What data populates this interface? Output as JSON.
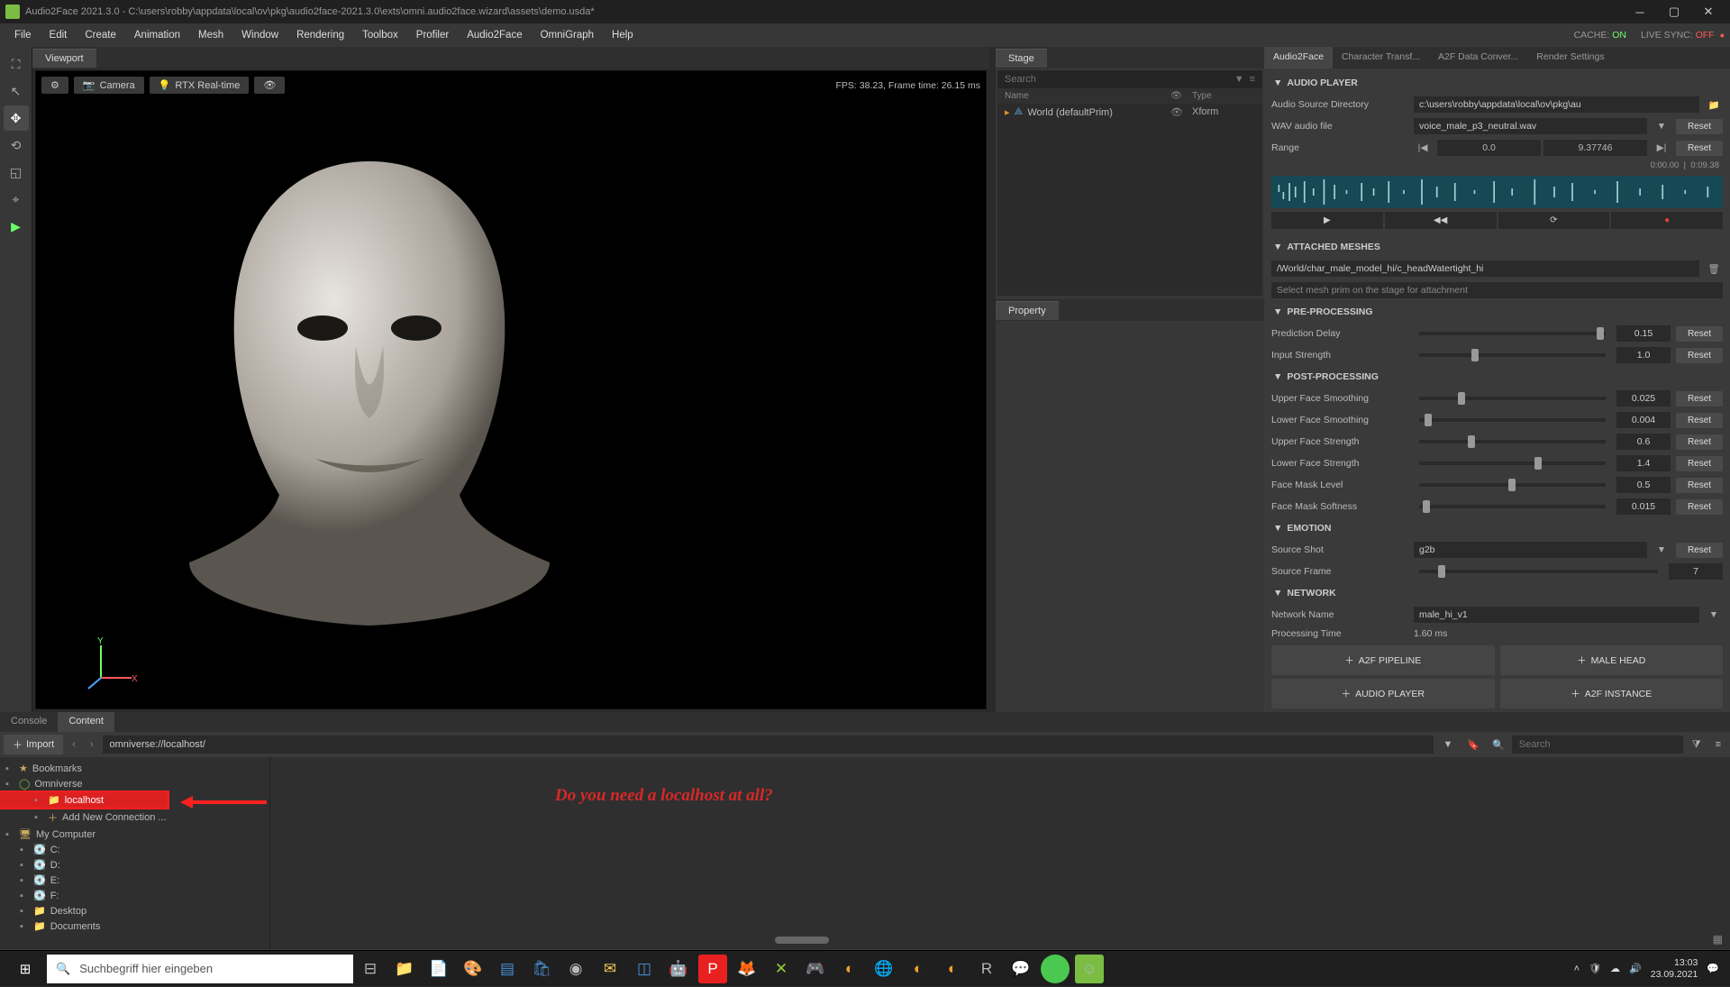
{
  "title": "Audio2Face 2021.3.0 - C:\\users\\robby\\appdata\\local\\ov\\pkg\\audio2face-2021.3.0\\exts\\omni.audio2face.wizard\\assets\\demo.usda*",
  "menu": [
    "File",
    "Edit",
    "Create",
    "Animation",
    "Mesh",
    "Window",
    "Rendering",
    "Toolbox",
    "Profiler",
    "Audio2Face",
    "OmniGraph",
    "Help"
  ],
  "cache_label": "CACHE:",
  "cache_state": "ON",
  "livesync_label": "LIVE SYNC:",
  "livesync_state": "OFF",
  "viewport_tab": "Viewport",
  "vp_camera": "Camera",
  "vp_rtx": "RTX Real-time",
  "vp_fps": "FPS: 38.23, Frame time: 26.15 ms",
  "stage_tab": "Stage",
  "stage_search_ph": "Search",
  "stage_cols": {
    "c1": "Name",
    "c2": "",
    "c3": "Type"
  },
  "stage_row": {
    "name": "World (defaultPrim)",
    "type": "Xform"
  },
  "property_tab": "Property",
  "rc2_tabs": [
    "Audio2Face",
    "Character Transf...",
    "A2F Data Conver...",
    "Render Settings"
  ],
  "audio_player": "AUDIO PLAYER",
  "audio_dir_lbl": "Audio Source Directory",
  "audio_dir_val": "c:\\users\\robby\\appdata\\local\\ov\\pkg\\au",
  "wav_lbl": "WAV audio file",
  "wav_val": "voice_male_p3_neutral.wav",
  "reset": "Reset",
  "range_lbl": "Range",
  "range_a": "0.0",
  "range_b": "9.37746",
  "time_a": "0:00.00",
  "time_b": "0:09.38",
  "attached_meshes": "ATTACHED MESHES",
  "mesh_path": "/World/char_male_model_hi/c_headWatertight_hi",
  "mesh_hint": "Select mesh prim on the stage for attachment",
  "preproc": "PRE-PROCESSING",
  "pp": [
    {
      "l": "Prediction Delay",
      "v": "0.15",
      "p": 95
    },
    {
      "l": "Input Strength",
      "v": "1.0",
      "p": 28
    }
  ],
  "postproc": "POST-PROCESSING",
  "po": [
    {
      "l": "Upper Face Smoothing",
      "v": "0.025",
      "p": 21
    },
    {
      "l": "Lower Face Smoothing",
      "v": "0.004",
      "p": 3
    },
    {
      "l": "Upper Face Strength",
      "v": "0.6",
      "p": 26
    },
    {
      "l": "Lower Face Strength",
      "v": "1.4",
      "p": 62
    },
    {
      "l": "Face Mask Level",
      "v": "0.5",
      "p": 48
    },
    {
      "l": "Face Mask Softness",
      "v": "0.015",
      "p": 2
    }
  ],
  "emotion": "EMOTION",
  "em_shot_l": "Source Shot",
  "em_shot_v": "g2b",
  "em_frame_l": "Source Frame",
  "em_frame_v": "7",
  "em_frame_p": 8,
  "network": "NETWORK",
  "net_name_l": "Network Name",
  "net_name_v": "male_hi_v1",
  "proc_time_l": "Processing Time",
  "proc_time_v": "1.60 ms",
  "btns": [
    "A2F PIPELINE",
    "MALE HEAD",
    "AUDIO PLAYER",
    "A2F INSTANCE"
  ],
  "console_tab": "Console",
  "content_tab": "Content",
  "import_btn": "Import",
  "content_path": "omniverse://localhost/",
  "content_search_ph": "Search",
  "tree": [
    {
      "t": "Bookmarks",
      "i": "★",
      "d": 0
    },
    {
      "t": "Omniverse",
      "i": "◯",
      "d": 0,
      "ov": true
    },
    {
      "t": "localhost",
      "i": "📁",
      "d": 2,
      "hl": true
    },
    {
      "t": "Add New Connection ...",
      "i": "＋",
      "d": 2
    },
    {
      "t": "My Computer",
      "i": "🖥",
      "d": 0
    },
    {
      "t": "C:",
      "i": "💽",
      "d": 1
    },
    {
      "t": "D:",
      "i": "💽",
      "d": 1
    },
    {
      "t": "E:",
      "i": "💽",
      "d": 1
    },
    {
      "t": "F:",
      "i": "💽",
      "d": 1
    },
    {
      "t": "Desktop",
      "i": "📁",
      "d": 1
    },
    {
      "t": "Documents",
      "i": "📁",
      "d": 1
    }
  ],
  "annotation": "Do you need a localhost at all?",
  "tb_search_ph": "Suchbegriff hier eingeben",
  "clock_time": "13:03",
  "clock_date": "23.09.2021"
}
